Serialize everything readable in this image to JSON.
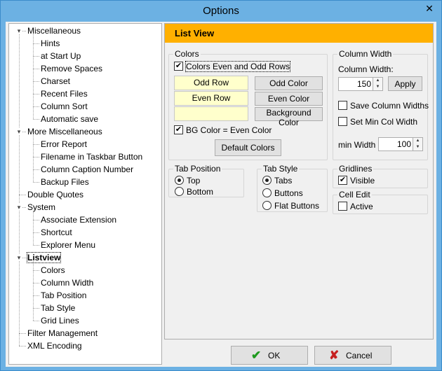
{
  "window": {
    "title": "Options",
    "close_glyph": "✕"
  },
  "tree": [
    {
      "label": "Miscellaneous",
      "level": 0,
      "expander": "▾"
    },
    {
      "label": "Hints",
      "level": 1
    },
    {
      "label": "at Start Up",
      "level": 1
    },
    {
      "label": "Remove Spaces",
      "level": 1
    },
    {
      "label": "Charset",
      "level": 1
    },
    {
      "label": "Recent Files",
      "level": 1
    },
    {
      "label": "Column Sort",
      "level": 1
    },
    {
      "label": "Automatic save",
      "level": 1
    },
    {
      "label": "More Miscellaneous",
      "level": 0,
      "expander": "▾"
    },
    {
      "label": "Error Report",
      "level": 1
    },
    {
      "label": "Filename in Taskbar Button",
      "level": 1
    },
    {
      "label": "Column Caption Number",
      "level": 1
    },
    {
      "label": "Backup Files",
      "level": 1
    },
    {
      "label": "Double Quotes",
      "level": 0
    },
    {
      "label": "System",
      "level": 0,
      "expander": "▾"
    },
    {
      "label": "Associate Extension",
      "level": 1
    },
    {
      "label": "Shortcut",
      "level": 1
    },
    {
      "label": "Explorer Menu",
      "level": 1
    },
    {
      "label": "Listview",
      "level": 0,
      "expander": "▾",
      "selected": true
    },
    {
      "label": "Colors",
      "level": 1
    },
    {
      "label": "Column Width",
      "level": 1
    },
    {
      "label": "Tab Position",
      "level": 1
    },
    {
      "label": "Tab Style",
      "level": 1
    },
    {
      "label": "Grid Lines",
      "level": 1
    },
    {
      "label": "Filter Management",
      "level": 0
    },
    {
      "label": "XML Encoding",
      "level": 0
    }
  ],
  "panel": {
    "header": "List View",
    "colors": {
      "title": "Colors",
      "even_odd_label": "Colors Even and Odd Rows",
      "even_odd_checked": "✔",
      "odd_row": "Odd Row",
      "even_row": "Even Row",
      "odd_color_btn": "Odd Color",
      "even_color_btn": "Even Color",
      "background_color_btn": "Background Color",
      "bg_even_label": "BG Color = Even Color",
      "bg_even_checked": "✔",
      "default_colors_btn": "Default Colors",
      "swatch_color": "#ffffcc"
    },
    "column_width": {
      "title": "Column Width",
      "label": "Column Width:",
      "value": "150",
      "apply_btn": "Apply",
      "save_widths_label": "Save Column Widths",
      "set_min_label": "Set Min Col Width",
      "min_width_label": "min Width",
      "min_width_value": "100"
    },
    "tab_position": {
      "title": "Tab Position",
      "options": [
        "Top",
        "Bottom"
      ],
      "selected": "Top"
    },
    "tab_style": {
      "title": "Tab Style",
      "options": [
        "Tabs",
        "Buttons",
        "Flat Buttons"
      ],
      "selected": "Tabs"
    },
    "gridlines": {
      "title": "Gridlines",
      "visible_label": "Visible",
      "visible_checked": "✔"
    },
    "cell_edit": {
      "title": "Cell Edit",
      "active_label": "Active"
    }
  },
  "footer": {
    "ok_label": "OK",
    "cancel_label": "Cancel",
    "ok_icon_color": "#1e9a1e",
    "cancel_icon_color": "#c62020"
  },
  "colors": {
    "header_bg": "#ffb000",
    "titlebar_bg": "#6cb1e3"
  }
}
